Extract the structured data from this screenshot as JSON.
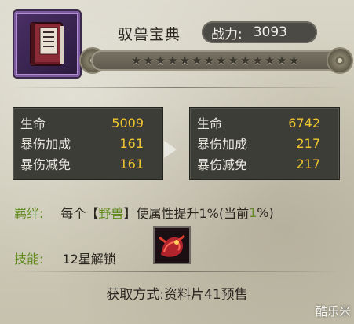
{
  "header": {
    "title": "驭兽宝典",
    "power_label": "战力:",
    "power_value": "3093",
    "icon": "book-icon",
    "star_count": 14,
    "filled_stars": 0
  },
  "stats_current": [
    {
      "label": "生命",
      "value": "5009"
    },
    {
      "label": "暴伤加成",
      "value": "161"
    },
    {
      "label": "暴伤减免",
      "value": "161"
    }
  ],
  "stats_next": [
    {
      "label": "生命",
      "value": "6742"
    },
    {
      "label": "暴伤加成",
      "value": "217"
    },
    {
      "label": "暴伤减免",
      "value": "217"
    }
  ],
  "bond": {
    "label": "羁绊:",
    "text_prefix": "每个【",
    "highlight": "野兽",
    "text_mid": "】使属性提升1%(当前",
    "current_count": "1",
    "text_suffix": "%)"
  },
  "skill": {
    "label": "技能:",
    "unlock_text": "12星解锁",
    "icon": "beast-skill-icon"
  },
  "footer": {
    "acquire_text": "获取方式:资料片41预售"
  },
  "watermark": "酷乐米",
  "colors": {
    "value_yellow": "#f0c531",
    "label_green": "#5f8a1e",
    "panel_bg": "#3c3d37"
  }
}
